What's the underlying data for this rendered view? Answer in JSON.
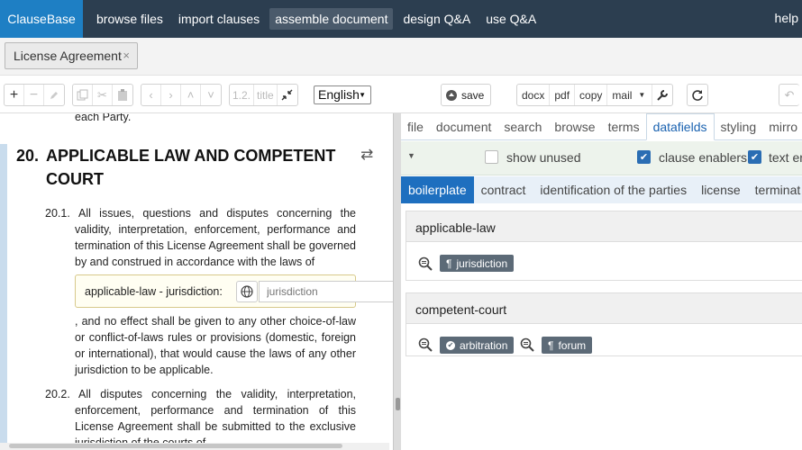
{
  "topnav": {
    "brand": "ClauseBase",
    "items": [
      "browse files",
      "import clauses",
      "assemble document",
      "design Q&A",
      "use Q&A"
    ],
    "active_index": 2,
    "help": "help"
  },
  "doc_tab": {
    "label": "License Agreement",
    "close": "×"
  },
  "toolbar": {
    "level_label": "1.2.",
    "title_label": "title",
    "language": "English",
    "save_label": "save",
    "export": {
      "docx": "docx",
      "pdf": "pdf",
      "copy": "copy",
      "mail": "mail"
    }
  },
  "document": {
    "prev_text": "each Party.",
    "article_number": "20.",
    "article_title": "APPLICABLE LAW AND COMPETENT COURT",
    "clause1_number": "20.1.",
    "clause1_text_a": "All issues, questions and disputes concerning the validity, interpretation, enforcement, performance and termination of this License Agreement shall be governed by and construed in accordance with the laws of",
    "field_label": "applicable-law - jurisdiction:",
    "field_placeholder": "jurisdiction",
    "clause1_text_b": ", and no effect shall be given to any other choice-of-law or conflict-of-laws rules or provisions (domestic, foreign or international), that would cause the laws of any other jurisdiction to be applicable.",
    "clause2_number": "20.2.",
    "clause2_text": "All disputes concerning the validity, interpretation, enforcement, performance and termination of this License Agreement shall be submitted to the exclusive jurisdiction of the courts of"
  },
  "right": {
    "tabs": [
      "file",
      "document",
      "search",
      "browse",
      "terms",
      "datafields",
      "styling",
      "mirro"
    ],
    "active_tab": 5,
    "options": {
      "show_unused": "show unused",
      "clause_enablers": "clause enablers",
      "text_enablers": "text er"
    },
    "categories": [
      "boilerplate",
      "contract",
      "identification of the parties",
      "license",
      "terminat"
    ],
    "active_category": 0,
    "panels": [
      {
        "title": "applicable-law",
        "tags": [
          "jurisdiction"
        ]
      },
      {
        "title": "competent-court",
        "tags": [
          "arbitration",
          "forum"
        ]
      }
    ]
  }
}
